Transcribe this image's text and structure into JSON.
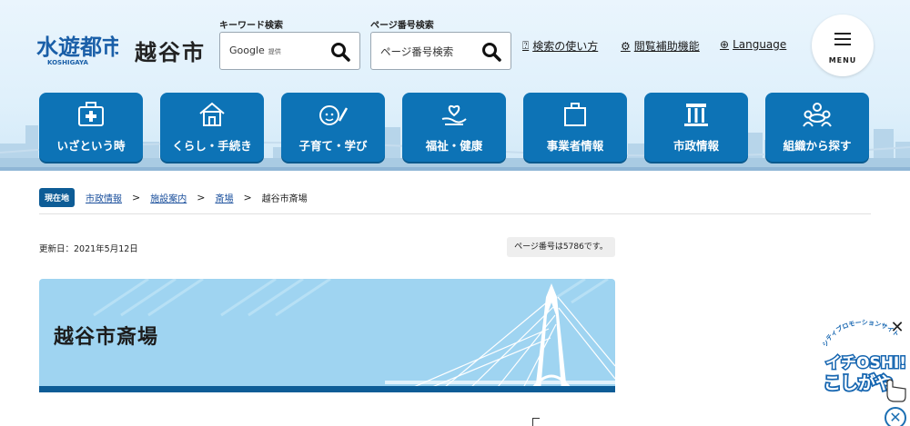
{
  "header": {
    "logo_text": "水遊都市",
    "logo_sub": "KOSHIGAYA",
    "city_name": "越谷市",
    "keyword_search": {
      "label": "キーワード検索",
      "value": "Google",
      "provider": "提供"
    },
    "page_search": {
      "label": "ページ番号検索",
      "placeholder": "ページ番号検索"
    },
    "links": [
      {
        "icon": "question-circle-icon",
        "label": "検索の使い方"
      },
      {
        "icon": "gear-icon",
        "label": "閲覧補助機能"
      },
      {
        "icon": "globe-icon",
        "label": "Language"
      }
    ],
    "menu_label": "MENU"
  },
  "nav": [
    {
      "label": "いざという時",
      "icon": "first-aid-kit-icon"
    },
    {
      "label": "くらし・手続き",
      "icon": "house-icon"
    },
    {
      "label": "子育て・学び",
      "icon": "child-face-pencil-icon"
    },
    {
      "label": "福祉・健康",
      "icon": "heart-hand-icon"
    },
    {
      "label": "事業者情報",
      "icon": "briefcase-icon"
    },
    {
      "label": "市政情報",
      "icon": "city-hall-icon"
    },
    {
      "label": "組織から探す",
      "icon": "people-group-icon"
    }
  ],
  "breadcrumb": {
    "current_label": "現在地",
    "items": [
      "市政情報",
      "施設案内",
      "斎場"
    ],
    "separator": ">",
    "current": "越谷市斎場"
  },
  "meta": {
    "updated": "更新日：2021年5月12日",
    "page_number": "ページ番号は5786です。"
  },
  "page_title": "越谷市斎場",
  "promo": {
    "top_text": "シティプロモーションサイト",
    "main_text_1": "イチOSHI!",
    "main_text_2": "こしがや"
  },
  "colors": {
    "nav_tile": "#0d73b6",
    "header_bg": "#eaf5fd",
    "banner_bg": "#9fd4f1",
    "accent_dark": "#0d5c96"
  }
}
